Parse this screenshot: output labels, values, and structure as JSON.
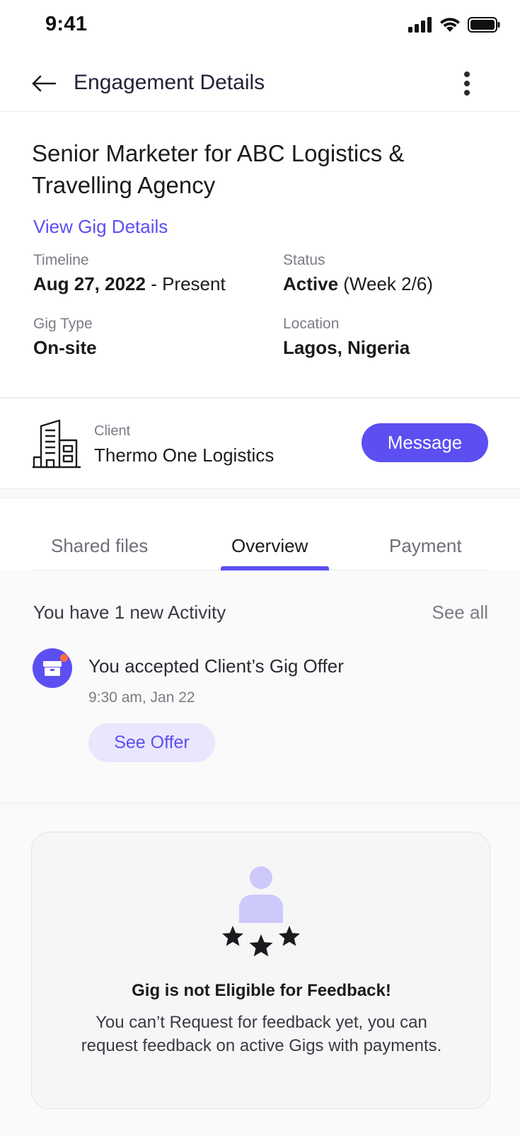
{
  "status_bar": {
    "time": "9:41"
  },
  "header": {
    "title": "Engagement Details"
  },
  "gig": {
    "title": "Senior Marketer for ABC Logistics & Travelling Agency",
    "link_label": "View Gig Details",
    "timeline_label": "Timeline",
    "timeline_value": "Aug 27, 2022",
    "timeline_suffix": " - Present",
    "status_label": "Status",
    "status_value": "Active",
    "status_suffix": " (Week 2/6)",
    "type_label": "Gig Type",
    "type_value": "On-site",
    "location_label": "Location",
    "location_value": "Lagos, Nigeria"
  },
  "client": {
    "label": "Client",
    "name": "Thermo One Logistics",
    "message_label": "Message"
  },
  "tabs": [
    {
      "label": "Shared files",
      "active": false
    },
    {
      "label": "Overview",
      "active": true
    },
    {
      "label": "Payment",
      "active": false
    }
  ],
  "activity": {
    "heading": "You have 1 new Activity",
    "see_all": "See all",
    "item_text": "You accepted Client’s Gig Offer",
    "item_time": "9:30 am, Jan 22",
    "offer_button": "See Offer"
  },
  "feedback": {
    "title": "Gig is not Eligible for Feedback!",
    "description": "You can’t Request for feedback yet, you can request feedback on active Gigs with payments."
  },
  "colors": {
    "accent": "#5b4ff2",
    "accent_light": "#e9e6fd",
    "notification_dot": "#ff6a3d"
  }
}
